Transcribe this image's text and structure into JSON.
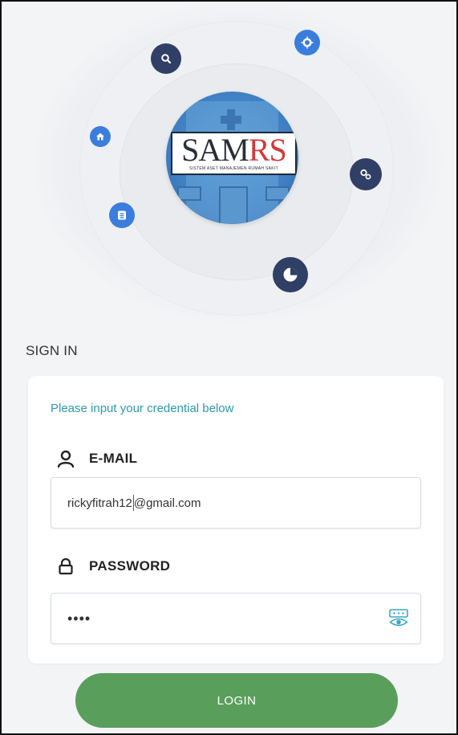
{
  "logo": {
    "brand_part1": "SAM",
    "brand_part2": "RS",
    "tagline": "SISTEM ASET MANAJEMEN RUMAH SAKIT"
  },
  "signin": {
    "title": "SIGN IN",
    "subtitle": "Please input your credential below"
  },
  "email": {
    "label": "E-MAIL",
    "value_before_caret": "rickyfitrah12",
    "value_after_caret": "@gmail.com"
  },
  "password": {
    "label": "PASSWORD",
    "masked_value": "••••"
  },
  "login": {
    "label": "LOGIN"
  },
  "icons": [
    "search-icon",
    "target-icon",
    "home-icon",
    "settings-icon",
    "document-icon",
    "pie-chart-icon",
    "user-icon",
    "lock-icon",
    "eye-icon"
  ],
  "colors": {
    "background": "#f3f4f6",
    "card": "#ffffff",
    "accent_teal": "#2a9bb0",
    "login_green": "#5a9e5c",
    "orb_dark": "#2f3f66",
    "orb_blue": "#3b7ddd",
    "brand_red": "#d23a3a"
  }
}
